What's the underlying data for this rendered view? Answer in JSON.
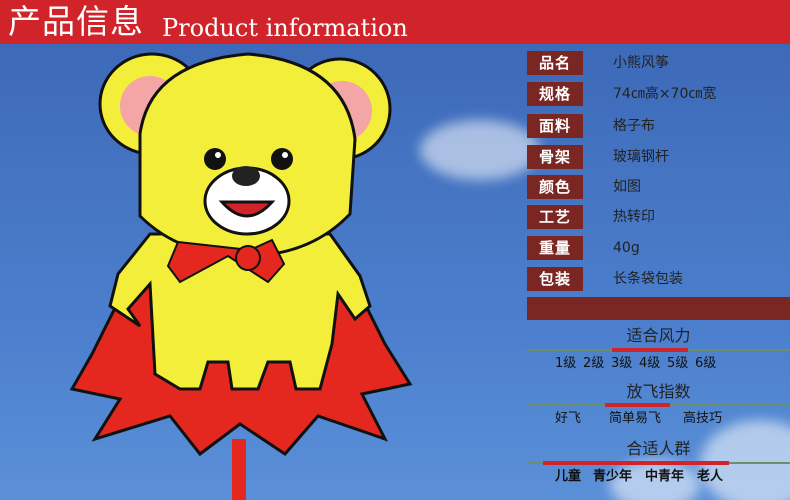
{
  "header": {
    "title_cn": "产品信息",
    "title_en": "Product information"
  },
  "specs": [
    {
      "label": "品名",
      "value": "小熊风筝"
    },
    {
      "label": "规格",
      "value": "74㎝高×70㎝宽"
    },
    {
      "label": "面料",
      "value": "格子布"
    },
    {
      "label": "骨架",
      "value": "玻璃钢杆"
    },
    {
      "label": "颜色",
      "value": "如图"
    },
    {
      "label": "工艺",
      "value": "热转印"
    },
    {
      "label": "重量",
      "value": "40g"
    },
    {
      "label": "包装",
      "value": "长条袋包装"
    }
  ],
  "wind": {
    "title": "适合风力",
    "levels": [
      "1级",
      "2级",
      "3级",
      "4级",
      "5级",
      "6级"
    ]
  },
  "difficulty": {
    "title": "放飞指数",
    "levels": [
      "好飞",
      "简单易飞",
      "高技巧"
    ]
  },
  "audience": {
    "title": "合适人群",
    "groups": [
      "儿童",
      "青少年",
      "中青年",
      "老人"
    ]
  },
  "colors": {
    "header_red": "#d0242a",
    "label_maroon": "#7a2623",
    "sky_blue": "#4474c2",
    "kite_yellow": "#f2ee3a",
    "cape_red": "#e5281f"
  }
}
